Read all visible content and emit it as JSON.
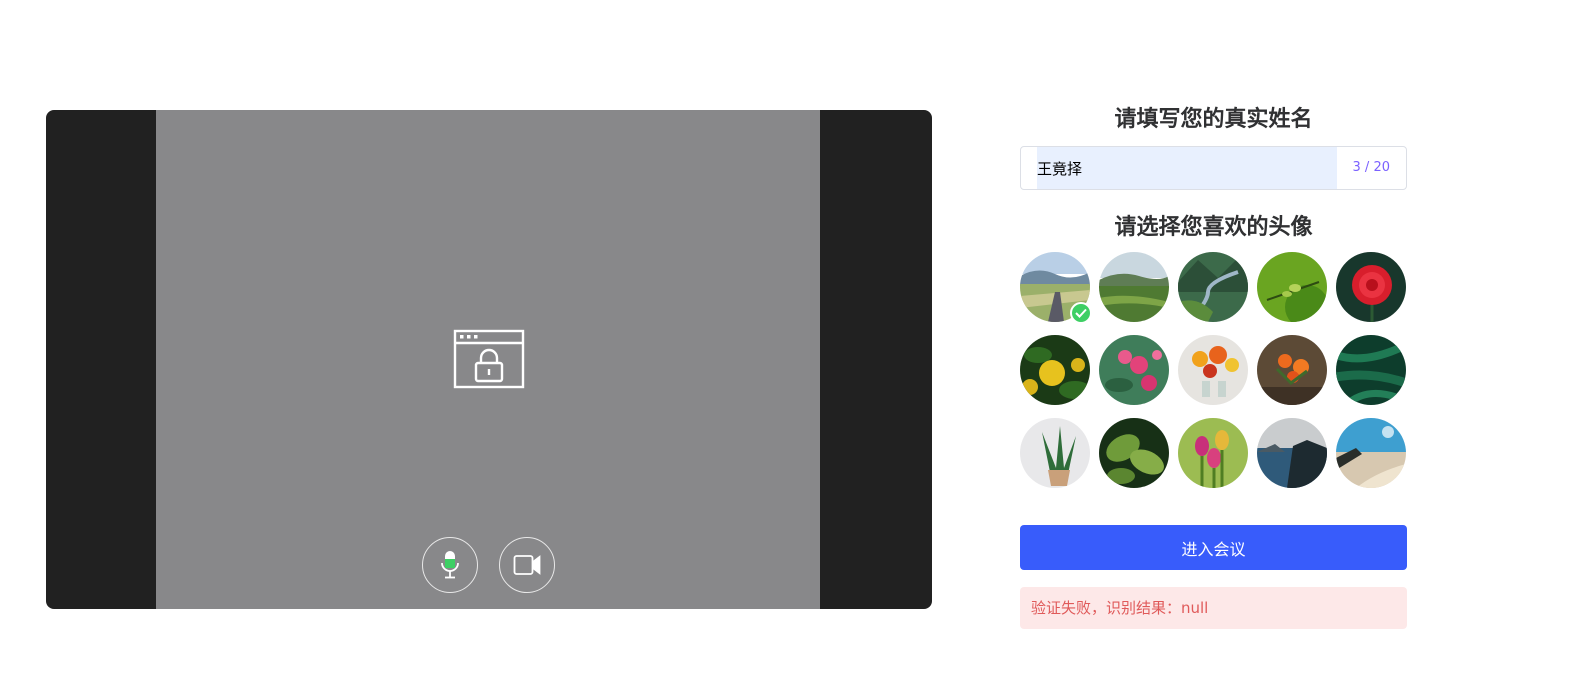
{
  "preview": {
    "mic_state": "on",
    "camera_state": "off",
    "lock_icon": "browser-lock-icon",
    "mic_icon": "microphone-icon",
    "camera_icon": "video-camera-icon"
  },
  "form": {
    "name_title": "请填写您的真实姓名",
    "name_value": "王竟择",
    "name_count": "3 / 20",
    "avatar_title": "请选择您喜欢的头像",
    "selected_avatar": 1,
    "enter_button": "进入会议",
    "error_message": "验证失败，识别结果：null"
  },
  "colors": {
    "primary": "#385cfb",
    "success": "#3ecf64",
    "error_bg": "#fde8e8",
    "error_text": "#e05a5a"
  }
}
